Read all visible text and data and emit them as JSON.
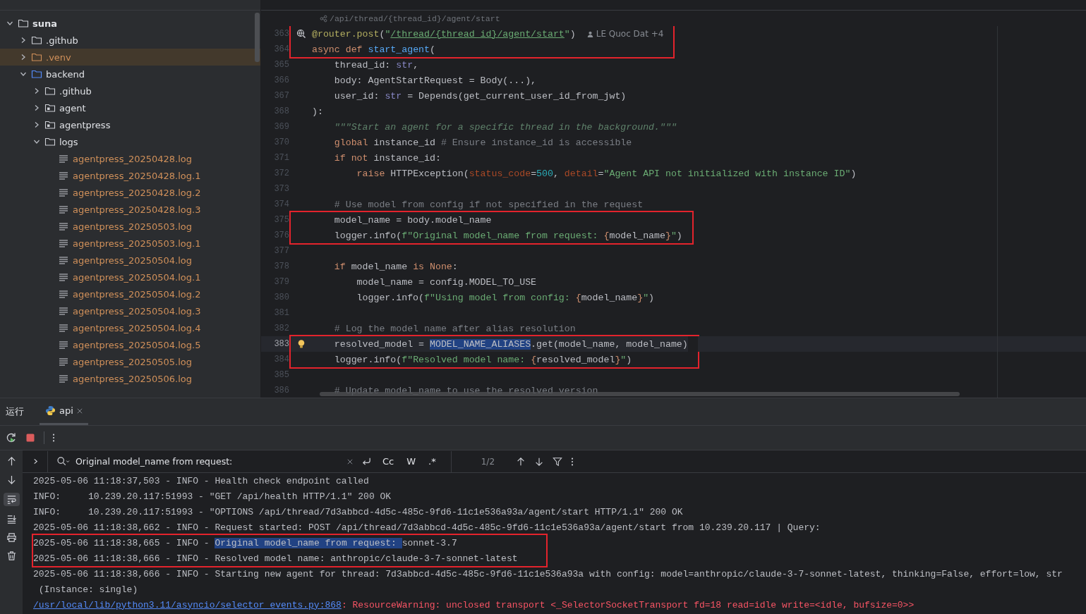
{
  "project_tree": [
    {
      "name": "suna",
      "kind": "root",
      "expanded": true,
      "selected": false,
      "ignored": false,
      "children": [
        {
          "name": ".github",
          "kind": "folder",
          "expanded": false,
          "selected": false,
          "ignored": false
        },
        {
          "name": ".venv",
          "kind": "folder",
          "expanded": false,
          "selected": true,
          "ignored": true
        },
        {
          "name": "backend",
          "kind": "source_root",
          "expanded": true,
          "selected": false,
          "ignored": false,
          "children": [
            {
              "name": ".github",
              "kind": "folder",
              "expanded": false,
              "selected": false,
              "ignored": false
            },
            {
              "name": "agent",
              "kind": "package",
              "expanded": false,
              "selected": false,
              "ignored": false
            },
            {
              "name": "agentpress",
              "kind": "package",
              "expanded": false,
              "selected": false,
              "ignored": false
            },
            {
              "name": "logs",
              "kind": "folder",
              "expanded": true,
              "selected": false,
              "ignored": false,
              "children": [
                {
                  "name": "agentpress_20250428.log",
                  "kind": "file",
                  "selected": false,
                  "ignored": true
                },
                {
                  "name": "agentpress_20250428.log.1",
                  "kind": "file",
                  "selected": false,
                  "ignored": true
                },
                {
                  "name": "agentpress_20250428.log.2",
                  "kind": "file",
                  "selected": false,
                  "ignored": true
                },
                {
                  "name": "agentpress_20250428.log.3",
                  "kind": "file",
                  "selected": false,
                  "ignored": true
                },
                {
                  "name": "agentpress_20250503.log",
                  "kind": "file",
                  "selected": false,
                  "ignored": true
                },
                {
                  "name": "agentpress_20250503.log.1",
                  "kind": "file",
                  "selected": false,
                  "ignored": true
                },
                {
                  "name": "agentpress_20250504.log",
                  "kind": "file",
                  "selected": false,
                  "ignored": true
                },
                {
                  "name": "agentpress_20250504.log.1",
                  "kind": "file",
                  "selected": false,
                  "ignored": true
                },
                {
                  "name": "agentpress_20250504.log.2",
                  "kind": "file",
                  "selected": false,
                  "ignored": true
                },
                {
                  "name": "agentpress_20250504.log.3",
                  "kind": "file",
                  "selected": false,
                  "ignored": true
                },
                {
                  "name": "agentpress_20250504.log.4",
                  "kind": "file",
                  "selected": false,
                  "ignored": true
                },
                {
                  "name": "agentpress_20250504.log.5",
                  "kind": "file",
                  "selected": false,
                  "ignored": true
                },
                {
                  "name": "agentpress_20250505.log",
                  "kind": "file",
                  "selected": false,
                  "ignored": true
                },
                {
                  "name": "agentpress_20250506.log",
                  "kind": "file",
                  "selected": false,
                  "ignored": true
                }
              ]
            }
          ]
        }
      ]
    }
  ],
  "editor": {
    "route_hint": "/api/thread/{thread_id}/agent/start",
    "author_hint": "LE Quoc Dat +4",
    "lines": [
      {
        "number": "363",
        "current": false,
        "marked": true,
        "gutter": {
          "kind": "endpoint"
        },
        "author": true,
        "tokens": [
          {
            "text": "@router.post",
            "kind": "deco"
          },
          {
            "text": "(",
            "kind": "plain"
          },
          {
            "text": "\"",
            "kind": "str"
          },
          {
            "text": "/thread/{thread_id}/agent/start",
            "kind": "url"
          },
          {
            "text": "\"",
            "kind": "str"
          },
          {
            "text": ")",
            "kind": "plain"
          }
        ]
      },
      {
        "number": "364",
        "current": false,
        "marked": true,
        "tokens": [
          {
            "text": "async def ",
            "kind": "kw"
          },
          {
            "text": "start_agent",
            "kind": "fn"
          },
          {
            "text": "(",
            "kind": "plain"
          }
        ]
      },
      {
        "number": "365",
        "current": false,
        "marked": false,
        "tokens": [
          {
            "text": "    thread_id: ",
            "kind": "plain"
          },
          {
            "text": "str",
            "kind": "type"
          },
          {
            "text": ",",
            "kind": "plain"
          }
        ]
      },
      {
        "number": "366",
        "current": false,
        "marked": false,
        "tokens": [
          {
            "text": "    body: AgentStartRequest = Body(...),",
            "kind": "plain"
          }
        ]
      },
      {
        "number": "367",
        "current": false,
        "marked": false,
        "tokens": [
          {
            "text": "    user_id: ",
            "kind": "plain"
          },
          {
            "text": "str",
            "kind": "type"
          },
          {
            "text": " = Depends(get_current_user_id_from_jwt)",
            "kind": "plain"
          }
        ]
      },
      {
        "number": "368",
        "current": false,
        "marked": false,
        "tokens": [
          {
            "text": "):",
            "kind": "plain"
          }
        ]
      },
      {
        "number": "369",
        "current": false,
        "marked": false,
        "tokens": [
          {
            "text": "    \"\"\"Start an agent for a specific thread in the background.\"\"\"",
            "kind": "doc"
          }
        ]
      },
      {
        "number": "370",
        "current": false,
        "marked": false,
        "tokens": [
          {
            "text": "    global",
            "kind": "kw"
          },
          {
            "text": " instance_id ",
            "kind": "plain"
          },
          {
            "text": "# Ensure instance_id is accessible",
            "kind": "cmt"
          }
        ]
      },
      {
        "number": "371",
        "current": false,
        "marked": false,
        "tokens": [
          {
            "text": "    if not",
            "kind": "kw"
          },
          {
            "text": " instance_id:",
            "kind": "plain"
          }
        ]
      },
      {
        "number": "372",
        "current": false,
        "marked": false,
        "tokens": [
          {
            "text": "        raise",
            "kind": "kw"
          },
          {
            "text": " HTTPException(",
            "kind": "plain"
          },
          {
            "text": "status_code",
            "kind": "arg"
          },
          {
            "text": "=",
            "kind": "plain"
          },
          {
            "text": "500",
            "kind": "num"
          },
          {
            "text": ", ",
            "kind": "plain"
          },
          {
            "text": "detail",
            "kind": "arg"
          },
          {
            "text": "=",
            "kind": "plain"
          },
          {
            "text": "\"Agent API not initialized with instance ID\"",
            "kind": "str"
          },
          {
            "text": ")",
            "kind": "plain"
          }
        ]
      },
      {
        "number": "373",
        "current": false,
        "marked": false
      },
      {
        "number": "374",
        "current": false,
        "marked": false,
        "tokens": [
          {
            "text": "    # Use model from config if not specified in the request",
            "kind": "cmt"
          }
        ]
      },
      {
        "number": "375",
        "current": false,
        "marked": true,
        "tokens": [
          {
            "text": "    model_name = body.model_name",
            "kind": "plain"
          }
        ]
      },
      {
        "number": "376",
        "current": false,
        "marked": true,
        "tokens": [
          {
            "text": "    logger.info(",
            "kind": "plain"
          },
          {
            "text": "f\"Original model_name from request: ",
            "kind": "str"
          },
          {
            "text": "{",
            "kind": "brace"
          },
          {
            "text": "model_name",
            "kind": "plain"
          },
          {
            "text": "}",
            "kind": "brace"
          },
          {
            "text": "\"",
            "kind": "str"
          },
          {
            "text": ")",
            "kind": "plain"
          }
        ]
      },
      {
        "number": "377",
        "current": false,
        "marked": false
      },
      {
        "number": "378",
        "current": false,
        "marked": false,
        "tokens": [
          {
            "text": "    if",
            "kind": "kw"
          },
          {
            "text": " model_name ",
            "kind": "plain"
          },
          {
            "text": "is None",
            "kind": "kw"
          },
          {
            "text": ":",
            "kind": "plain"
          }
        ]
      },
      {
        "number": "379",
        "current": false,
        "marked": false,
        "tokens": [
          {
            "text": "        model_name = config.MODEL_TO_USE",
            "kind": "plain"
          }
        ]
      },
      {
        "number": "380",
        "current": false,
        "marked": false,
        "tokens": [
          {
            "text": "        logger.info(",
            "kind": "plain"
          },
          {
            "text": "f\"Using model from config: ",
            "kind": "str"
          },
          {
            "text": "{",
            "kind": "brace"
          },
          {
            "text": "model_name",
            "kind": "plain"
          },
          {
            "text": "}",
            "kind": "brace"
          },
          {
            "text": "\"",
            "kind": "str"
          },
          {
            "text": ")",
            "kind": "plain"
          }
        ]
      },
      {
        "number": "381",
        "current": false,
        "marked": false
      },
      {
        "number": "382",
        "current": false,
        "marked": false,
        "tokens": [
          {
            "text": "    # Log the model name after alias resolution",
            "kind": "cmt"
          }
        ]
      },
      {
        "number": "383",
        "current": true,
        "marked": true,
        "gutter": {
          "kind": "bulb"
        },
        "tokens": [
          {
            "text": "    resolved_model = ",
            "kind": "plain"
          },
          {
            "text": "MODEL_NAME_ALIASES",
            "kind": "sel"
          },
          {
            "text": ".get(model_name, model_name)",
            "kind": "plain"
          }
        ]
      },
      {
        "number": "384",
        "current": false,
        "marked": true,
        "tokens": [
          {
            "text": "    logger.info(",
            "kind": "plain"
          },
          {
            "text": "f\"Resolved model name: ",
            "kind": "str"
          },
          {
            "text": "{",
            "kind": "brace"
          },
          {
            "text": "resolved_model",
            "kind": "plain"
          },
          {
            "text": "}",
            "kind": "brace"
          },
          {
            "text": "\"",
            "kind": "str"
          },
          {
            "text": ")",
            "kind": "plain"
          }
        ]
      },
      {
        "number": "385",
        "current": false,
        "marked": false
      },
      {
        "number": "386",
        "current": false,
        "marked": false,
        "tokens": [
          {
            "text": "    # Update model_name to use the resolved version",
            "kind": "cmt"
          }
        ]
      }
    ]
  },
  "run_panel": {
    "title": "运行",
    "tabs": [
      {
        "label": "api",
        "selected": true
      }
    ],
    "search": {
      "value": "Original model_name from request:",
      "options": [
        {
          "label": "Cc",
          "selected": false
        },
        {
          "label": "W",
          "selected": false
        },
        {
          "label": ".*",
          "selected": false
        }
      ],
      "count": "1/2"
    },
    "console": [
      {
        "marked": false,
        "tokens": [
          {
            "text": "2025-05-06 11:18:37,503 - INFO - Health check endpoint called",
            "kind": "plain"
          }
        ]
      },
      {
        "marked": false,
        "tokens": [
          {
            "text": "INFO:     10.239.20.117:51993 - \"GET /api/health HTTP/1.1\" 200 OK",
            "kind": "plain"
          }
        ]
      },
      {
        "marked": false,
        "tokens": [
          {
            "text": "INFO:     10.239.20.117:51993 - \"OPTIONS /api/thread/7d3abbcd-4d5c-485c-9fd6-11c1e536a93a/agent/start HTTP/1.1\" 200 OK",
            "kind": "plain"
          }
        ]
      },
      {
        "marked": false,
        "tokens": [
          {
            "text": "2025-05-06 11:18:38,662 - INFO - Request started: POST /api/thread/7d3abbcd-4d5c-485c-9fd6-11c1e536a93a/agent/start from 10.239.20.117 | Query:",
            "kind": "plain"
          }
        ]
      },
      {
        "marked": true,
        "tokens": [
          {
            "text": "2025-05-06 11:18:38,665 - INFO - ",
            "kind": "plain"
          },
          {
            "text": "Original model_name from request: ",
            "kind": "match"
          },
          {
            "text": "sonnet-3.7",
            "kind": "plain"
          }
        ]
      },
      {
        "marked": true,
        "tokens": [
          {
            "text": "2025-05-06 11:18:38,666 - INFO - Resolved model name: anthropic/claude-3-7-sonnet-latest",
            "kind": "plain"
          }
        ]
      },
      {
        "marked": false,
        "tokens": [
          {
            "text": "2025-05-06 11:18:38,666 - INFO - Starting new agent for thread: 7d3abbcd-4d5c-485c-9fd6-11c1e536a93a with config: model=anthropic/claude-3-7-sonnet-latest, thinking=False, effort=low, str",
            "kind": "plain"
          }
        ]
      },
      {
        "marked": false,
        "tokens": [
          {
            "text": " (Instance: single)",
            "kind": "plain"
          }
        ]
      },
      {
        "marked": false,
        "tokens": [
          {
            "text": "/usr/local/lib/python3.11/asyncio/selector_events.py:868",
            "kind": "link"
          },
          {
            "text": ": ResourceWarning: unclosed transport <_SelectorSocketTransport fd=18 read=idle write=<idle, bufsize=0>>",
            "kind": "warn"
          }
        ]
      }
    ]
  }
}
